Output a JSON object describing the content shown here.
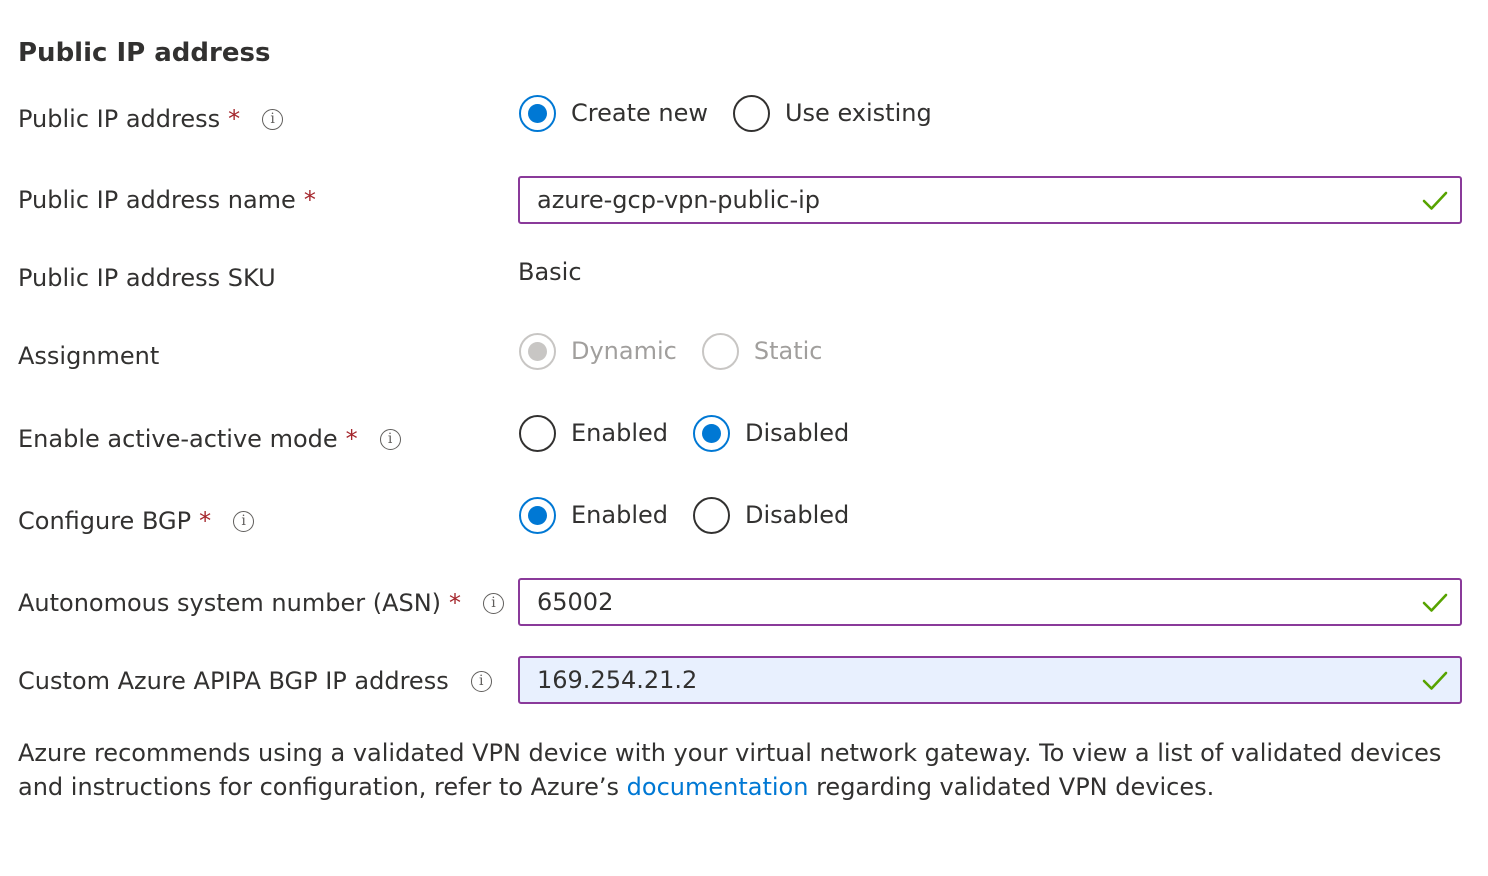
{
  "section_title": "Public IP address",
  "required_marker": "*",
  "info_icon_glyph": "i",
  "fields": {
    "public_ip": {
      "label": "Public IP address",
      "options": [
        "Create new",
        "Use existing"
      ],
      "selected": "Create new"
    },
    "public_ip_name": {
      "label": "Public IP address name",
      "value": "azure-gcp-vpn-public-ip"
    },
    "public_ip_sku": {
      "label": "Public IP address SKU",
      "value": "Basic"
    },
    "assignment": {
      "label": "Assignment",
      "options": [
        "Dynamic",
        "Static"
      ],
      "selected": "Dynamic",
      "disabled": true
    },
    "active_active": {
      "label": "Enable active-active mode",
      "options": [
        "Enabled",
        "Disabled"
      ],
      "selected": "Disabled"
    },
    "configure_bgp": {
      "label": "Configure BGP",
      "options": [
        "Enabled",
        "Disabled"
      ],
      "selected": "Enabled"
    },
    "asn": {
      "label": "Autonomous system number (ASN)",
      "value": "65002"
    },
    "apipa": {
      "label": "Custom Azure APIPA BGP IP address",
      "value": "169.254.21.2"
    }
  },
  "footer": {
    "text_before": "Azure recommends using a validated VPN device with your virtual network gateway. To view a list of validated devices and instructions for configuration, refer to Azure’s ",
    "link_text": "documentation",
    "text_after": " regarding validated VPN devices."
  },
  "colors": {
    "accent": "#0078d4",
    "required": "#a4262c",
    "field_border": "#8a3a9a",
    "valid_check": "#57a300",
    "autofill_bg": "#e8f0fe"
  }
}
